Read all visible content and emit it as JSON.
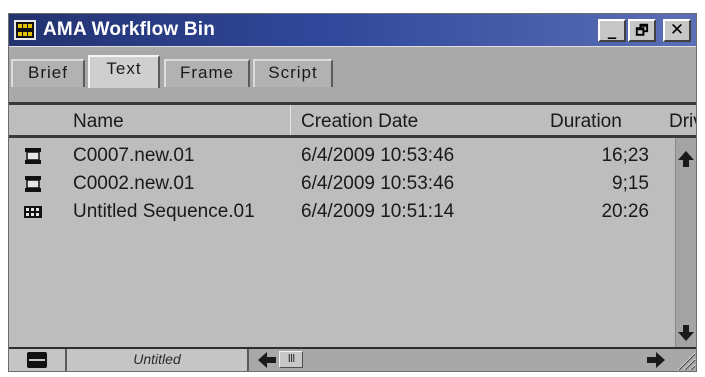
{
  "window": {
    "title": "AMA Workflow Bin",
    "app_icon": "film-bin-icon",
    "controls": {
      "minimize_label": "_",
      "maximize_label": "🗗",
      "close_label": "✕"
    }
  },
  "tabs": [
    {
      "label": "Brief",
      "active": false
    },
    {
      "label": "Text",
      "active": true
    },
    {
      "label": "Frame",
      "active": false
    },
    {
      "label": "Script",
      "active": false
    }
  ],
  "columns": {
    "name": "Name",
    "creation_date": "Creation Date",
    "duration": "Duration",
    "drive": "Driv"
  },
  "rows": [
    {
      "icon": "clip-icon",
      "name": "C0007.new.01",
      "creation_date": "6/4/2009 10:53:46",
      "duration": "16;23"
    },
    {
      "icon": "clip-icon",
      "name": "C0002.new.01",
      "creation_date": "6/4/2009 10:53:46",
      "duration": "9;15"
    },
    {
      "icon": "sequence-icon",
      "name": "Untitled Sequence.01",
      "creation_date": "6/4/2009 10:51:14",
      "duration": "20:26"
    }
  ],
  "statusbar": {
    "view_name": "Untitled",
    "hscroll_thumb_label": "III"
  },
  "colors": {
    "title_gradient_start": "#23336f",
    "title_gradient_end": "#5a6fb6",
    "panel_bg": "#bdbdbd"
  }
}
